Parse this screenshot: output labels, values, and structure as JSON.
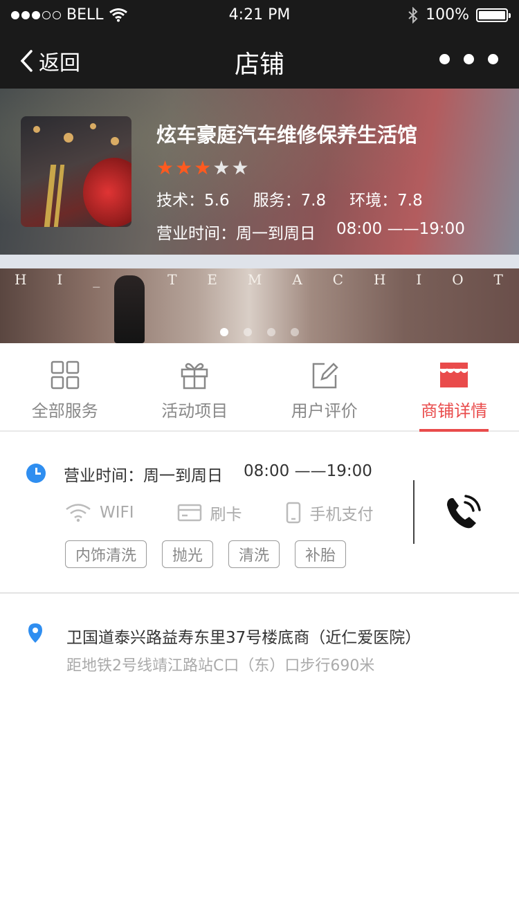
{
  "status_bar": {
    "carrier": "BELL",
    "time": "4:21 PM",
    "battery": "100%"
  },
  "nav": {
    "back_label": "返回",
    "title": "店铺"
  },
  "shop": {
    "name": "炫车豪庭汽车维修保养生活馆",
    "rating": {
      "filled": 3,
      "total": 5
    },
    "scores": [
      {
        "label": "技术：",
        "value": "5.6"
      },
      {
        "label": "服务：",
        "value": "7.8"
      },
      {
        "label": "环境：",
        "value": "7.8"
      }
    ],
    "hours_label": "营业时间：周一到周日",
    "hours_time": "08:00 ——19:00"
  },
  "banner": {
    "letters": [
      "H",
      "I",
      "_",
      "_",
      "T",
      "E",
      "M",
      "A",
      "C",
      "H",
      "I",
      "O",
      "T"
    ],
    "slide_count": 4,
    "active_slide": 0
  },
  "tabs": [
    {
      "label": "全部服务",
      "icon": "grid-icon"
    },
    {
      "label": "活动项目",
      "icon": "gift-icon"
    },
    {
      "label": "用户评价",
      "icon": "edit-icon"
    },
    {
      "label": "商铺详情",
      "icon": "store-icon",
      "active": true
    }
  ],
  "details": {
    "hours_label": "营业时间：周一到周日",
    "hours_time": "08:00 ——19:00",
    "features": [
      {
        "label": "WIFI",
        "icon": "wifi-icon"
      },
      {
        "label": "刷卡",
        "icon": "card-icon"
      },
      {
        "label": "手机支付",
        "icon": "mobile-icon"
      }
    ],
    "tags": [
      "内饰清洗",
      "抛光",
      "清洗",
      "补胎"
    ]
  },
  "address": {
    "line": "卫国道泰兴路益寿东里37号楼底商（近仁爱医院）",
    "transit": "距地铁2号线靖江路站C口（东）口步行690米"
  },
  "colors": {
    "accent": "#e94b4b",
    "star": "#ff5a1f",
    "clock": "#2f8ef0",
    "dark_bar": "#1a1a1a"
  }
}
